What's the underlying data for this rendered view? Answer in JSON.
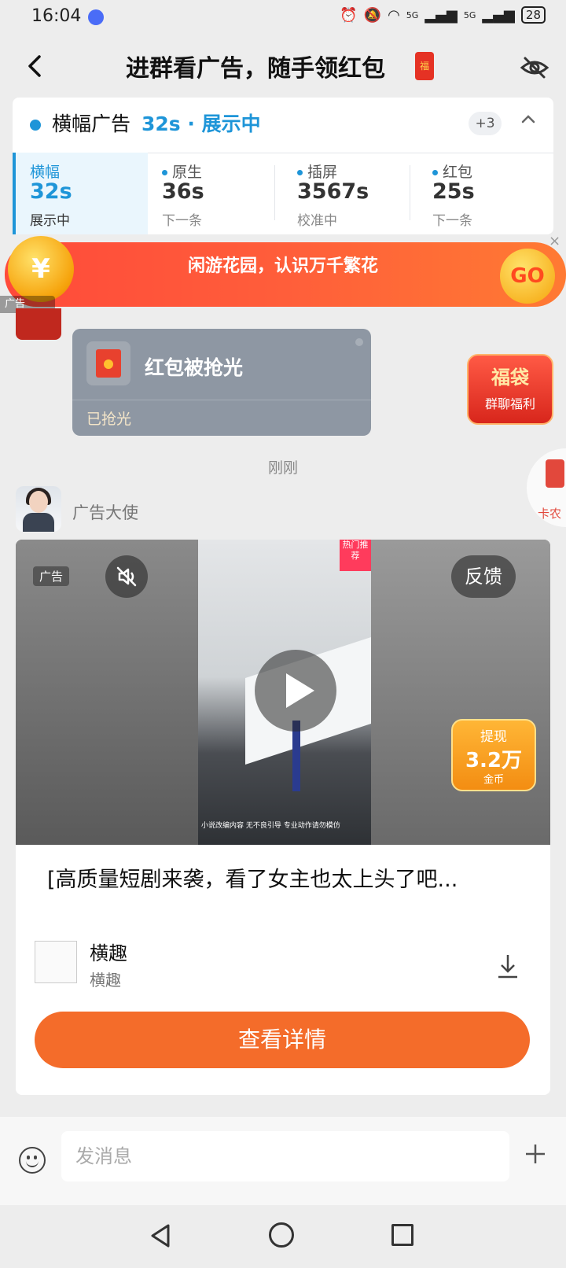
{
  "status_bar": {
    "time": "16:04",
    "signal_1": "5G",
    "signal_2": "5G",
    "battery": "28"
  },
  "header": {
    "title": "进群看广告，随手领红包",
    "title_icon": "red-envelope-icon"
  },
  "ad_panel": {
    "current_type": "横幅广告",
    "current_status": "32s · 展示中",
    "more_count": "+3",
    "tabs": [
      {
        "label": "横幅",
        "value": "32s",
        "sub": "展示中",
        "active": true
      },
      {
        "label": "原生",
        "value": "36s",
        "sub": "下一条",
        "active": false
      },
      {
        "label": "插屏",
        "value": "3567s",
        "sub": "校准中",
        "active": false
      },
      {
        "label": "红包",
        "value": "25s",
        "sub": "下一条",
        "active": false
      }
    ],
    "accent_color": "#1e95d8"
  },
  "banner_ad": {
    "text": "闲游花园，认识万千繁花",
    "go_label": "GO",
    "coin_symbol": "¥",
    "ad_tag": "广告",
    "close": "×"
  },
  "red_packet": {
    "title": "红包被抢光",
    "status": "已抢光"
  },
  "fudai": {
    "title": "福袋",
    "sub": "群聊福利"
  },
  "float_widget": {
    "text": "卡农"
  },
  "time_label": "刚刚",
  "ad_message": {
    "sender": "广告大使",
    "ad_tag": "广告",
    "feedback": "反馈",
    "withdraw_label": "提现",
    "withdraw_amount": "3.2万",
    "withdraw_unit": "金币",
    "title": "[高质量短剧来袭，看了女主也太上头了吧...",
    "app_name": "横趣",
    "app_sub": "横趣",
    "detail_button": "查看详情",
    "corner_tag": "热门推荐",
    "video_caption": "小说改编内容 无不良引导      专业动作请勿模仿",
    "accent_color": "#f46c2a"
  },
  "input_bar": {
    "placeholder": "发消息"
  }
}
